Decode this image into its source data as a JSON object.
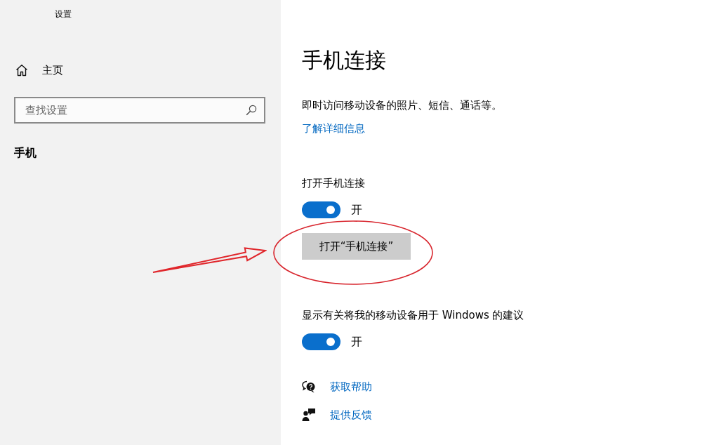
{
  "window": {
    "title": "设置"
  },
  "sidebar": {
    "home": {
      "label": "主页"
    },
    "search": {
      "placeholder": "查找设置"
    },
    "section": "手机"
  },
  "page": {
    "title": "手机连接",
    "description": "即时访问移动设备的照片、短信、通话等。",
    "link": "了解详细信息",
    "settings": [
      {
        "label": "打开手机连接",
        "on": true,
        "state_text": "开",
        "button": {
          "label": "打开“手机连接”",
          "highlighted": true
        }
      },
      {
        "label": "显示有关将我的移动设备用于 Windows 的建议",
        "on": true,
        "state_text": "开"
      }
    ],
    "help_links": [
      {
        "kind": "help",
        "label": "获取帮助"
      },
      {
        "kind": "feedback",
        "label": "提供反馈"
      }
    ]
  }
}
